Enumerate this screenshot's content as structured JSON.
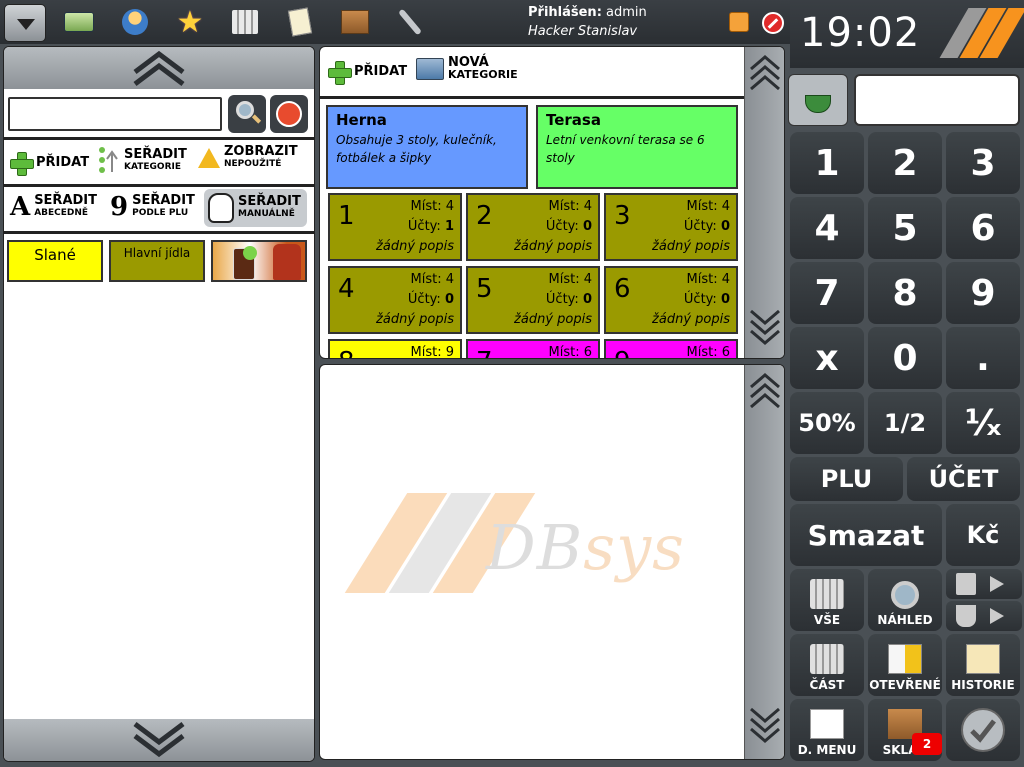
{
  "header": {
    "login_label": "Přihlášen:",
    "login_user": "admin",
    "user_name": "Hacker Stanislav",
    "time": "19:02",
    "icons": [
      "menu-icon",
      "card-icon",
      "user-icon",
      "star-icon",
      "coins-icon",
      "note-icon",
      "box-icon",
      "wrench-icon",
      "lock-icon",
      "stop-icon"
    ]
  },
  "left": {
    "search_placeholder": "",
    "toolbar1": {
      "add_label": "PŘIDAT",
      "sort_cat_big": "SEŘADIT",
      "sort_cat_small": "KATEGORIE",
      "show_big": "ZOBRAZIT",
      "show_small": "NEPOUŽITÉ"
    },
    "toolbar2": {
      "abc_letter": "A",
      "abc_big": "SEŘADIT",
      "abc_small": "ABECEDNĚ",
      "plu_letter": "9",
      "plu_big": "SEŘADIT",
      "plu_small": "PODLE PLU",
      "man_big": "SEŘADIT",
      "man_small": "MANUÁLNĚ"
    },
    "categories": [
      {
        "label": "Slané"
      },
      {
        "label": "Hlavní jídla"
      }
    ]
  },
  "center": {
    "add_label": "PŘIDAT",
    "new_cat_line1": "NOVÁ",
    "new_cat_line2": "KATEGORIE",
    "rooms": [
      {
        "title": "Herna",
        "desc": "Obsahuje 3 stoly, kulečník, fotbálek a šipky"
      },
      {
        "title": "Terasa",
        "desc": "Letní venkovní terasa se 6 stoly"
      }
    ],
    "tables": [
      {
        "num": "1",
        "seats_label": "Míst:",
        "seats": "4",
        "accounts_label": "Účty:",
        "accounts": "1",
        "desc": "žádný popis"
      },
      {
        "num": "2",
        "seats_label": "Míst:",
        "seats": "4",
        "accounts_label": "Účty:",
        "accounts": "0",
        "desc": "žádný popis"
      },
      {
        "num": "3",
        "seats_label": "Míst:",
        "seats": "4",
        "accounts_label": "Účty:",
        "accounts": "0",
        "desc": "žádný popis"
      },
      {
        "num": "4",
        "seats_label": "Míst:",
        "seats": "4",
        "accounts_label": "Účty:",
        "accounts": "0",
        "desc": "žádný popis"
      },
      {
        "num": "5",
        "seats_label": "Míst:",
        "seats": "4",
        "accounts_label": "Účty:",
        "accounts": "0",
        "desc": "žádný popis"
      },
      {
        "num": "6",
        "seats_label": "Míst:",
        "seats": "4",
        "accounts_label": "Účty:",
        "accounts": "0",
        "desc": "žádný popis"
      },
      {
        "num": "8",
        "seats_label": "Míst:",
        "seats": "9"
      },
      {
        "num": "7",
        "seats_label": "Míst:",
        "seats": "6"
      },
      {
        "num": "9",
        "seats_label": "Míst:",
        "seats": "6"
      }
    ],
    "watermark_db": "DB",
    "watermark_sys": "sys"
  },
  "keypad": {
    "digits": [
      "1",
      "2",
      "3",
      "4",
      "5",
      "6",
      "7",
      "8",
      "9"
    ],
    "x": "x",
    "zero": "0",
    "dot": ".",
    "pct": "50%",
    "half": "1/2",
    "recip": "¹⁄ₓ",
    "plu": "PLU",
    "ucet": "ÚČET",
    "smazat": "Smazat",
    "kc": "Kč",
    "vse": "VŠE",
    "nahled": "NÁHLED",
    "cast": "ČÁST",
    "otevrene": "OTEVŘENÉ",
    "historie": "HISTORIE",
    "dmenu": "D. MENU",
    "sklad": "SKLAD",
    "sklad_badge": "2"
  },
  "colors": {
    "herna": "#6699ff",
    "terasa": "#66ff66",
    "table_olive": "#9a9a00",
    "accent_orange": "#f7931e"
  }
}
